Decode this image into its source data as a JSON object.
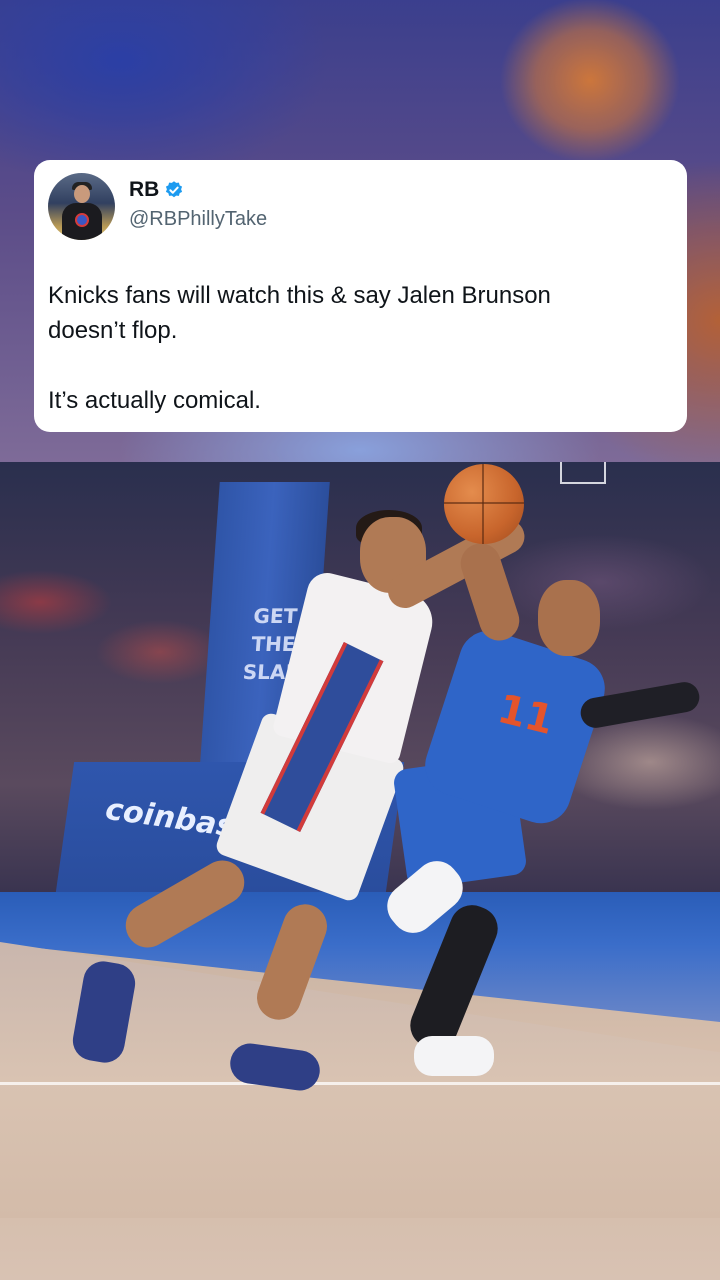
{
  "tweet": {
    "display_name": "RB",
    "verified": true,
    "handle": "@RBPhillyTake",
    "text": "Knicks fans will watch this & say Jalen Brunson\ndoesn’t flop.\n\nIt’s actually comical."
  },
  "video": {
    "stanchion_text": "GET THE SLAP",
    "court_wall_text": "coinbase",
    "jersey_number": "11"
  },
  "colors": {
    "verified_badge": "#1d9bf0",
    "card_background": "#ffffff",
    "handle_gray": "#536471",
    "text_dark": "#0f1419"
  },
  "icons": {
    "verified": "verified-badge-icon"
  }
}
